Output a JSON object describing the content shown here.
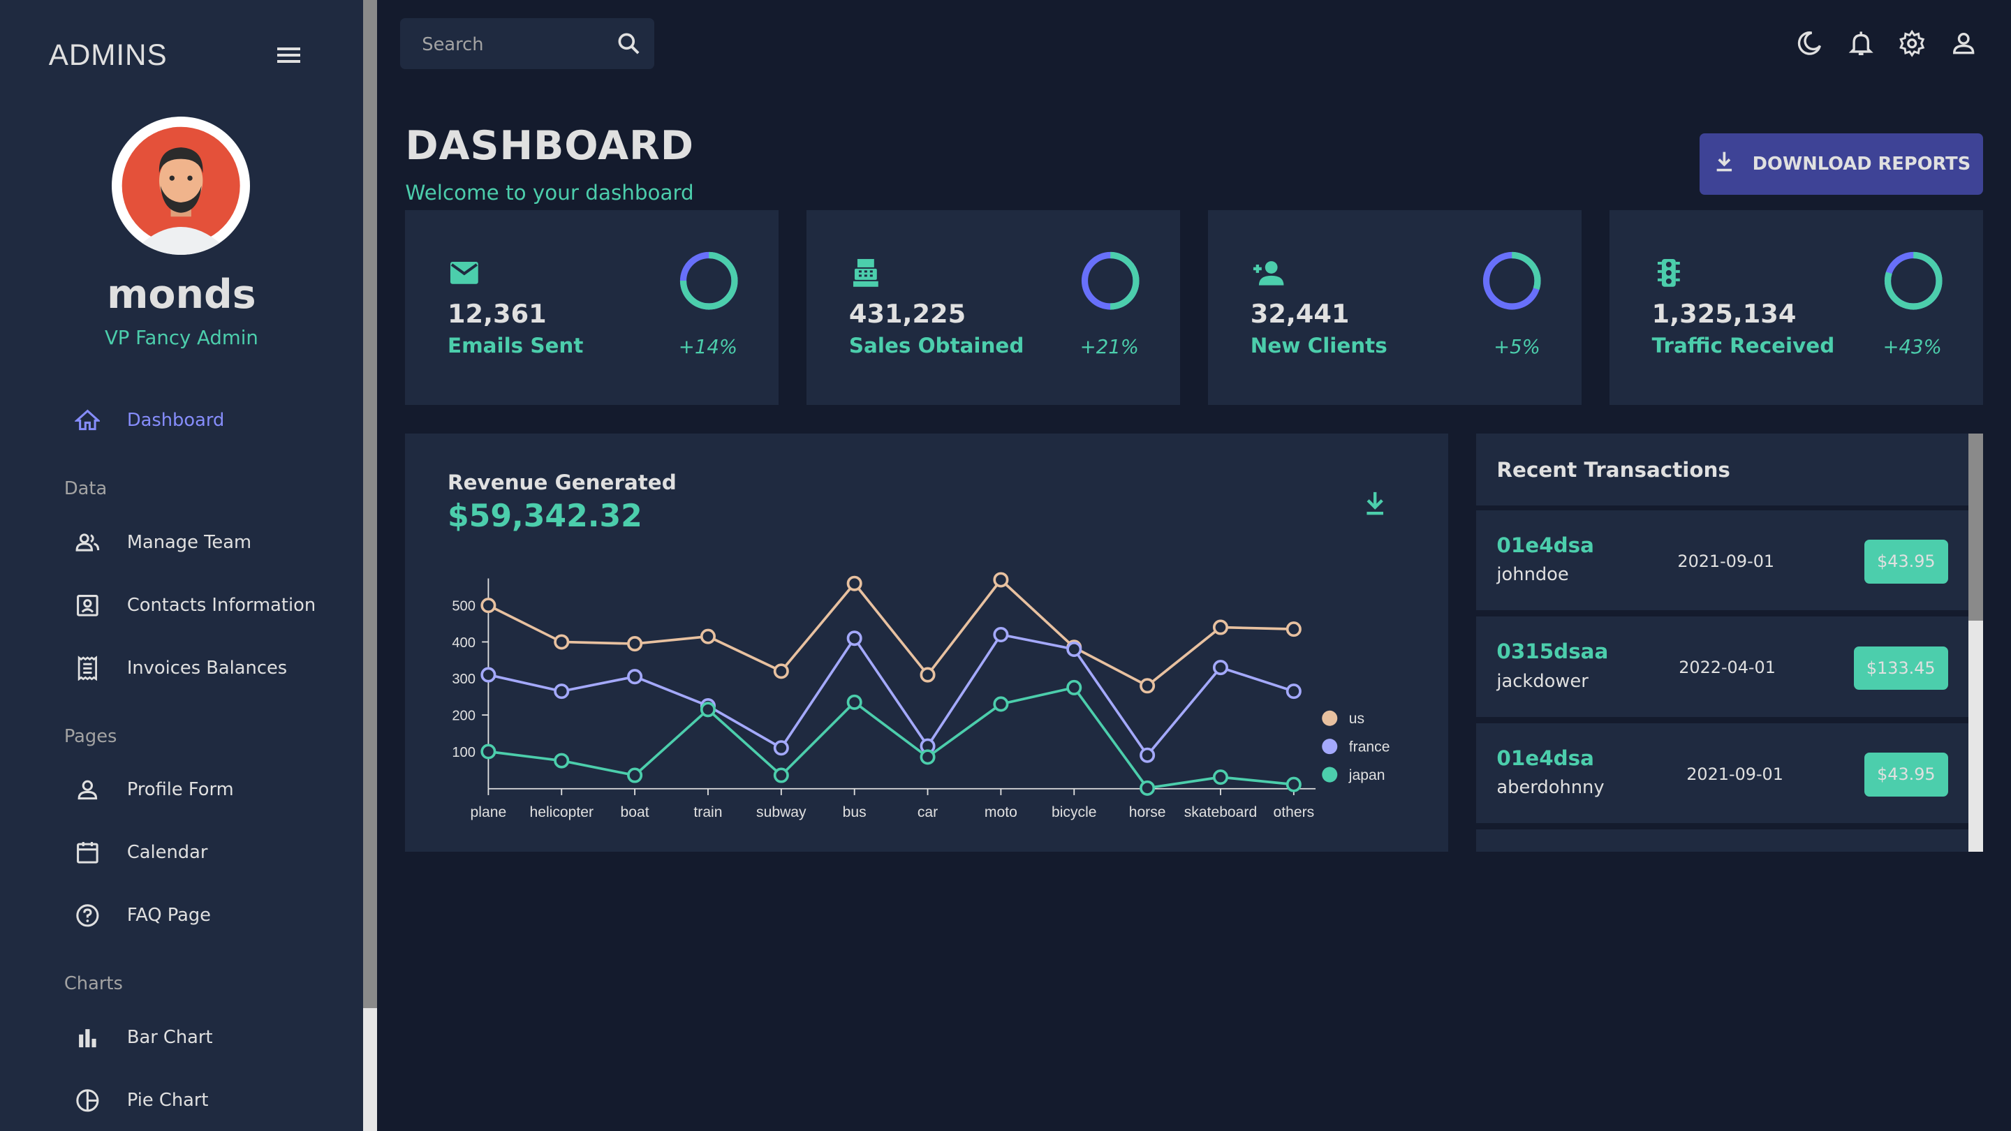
{
  "sidebar": {
    "brand": "ADMINS",
    "user": {
      "name": "monds",
      "role": "VP Fancy Admin"
    },
    "items": [
      {
        "label": "Dashboard",
        "icon": "home-icon",
        "active": true
      },
      {
        "section": "Data"
      },
      {
        "label": "Manage Team",
        "icon": "people-icon"
      },
      {
        "label": "Contacts Information",
        "icon": "contacts-icon"
      },
      {
        "label": "Invoices Balances",
        "icon": "receipt-icon"
      },
      {
        "section": "Pages"
      },
      {
        "label": "Profile Form",
        "icon": "person-icon"
      },
      {
        "label": "Calendar",
        "icon": "calendar-icon"
      },
      {
        "label": "FAQ Page",
        "icon": "help-icon"
      },
      {
        "section": "Charts"
      },
      {
        "label": "Bar Chart",
        "icon": "bar-chart-icon"
      },
      {
        "label": "Pie Chart",
        "icon": "pie-chart-icon"
      }
    ]
  },
  "topbar": {
    "search_placeholder": "Search",
    "icons": [
      "dark-mode-icon",
      "notifications-icon",
      "settings-icon",
      "person-icon"
    ]
  },
  "header": {
    "title": "DASHBOARD",
    "subtitle": "Welcome to your dashboard",
    "download_label": "DOWNLOAD REPORTS"
  },
  "stats": [
    {
      "value": "12,361",
      "label": "Emails Sent",
      "increase": "+14%",
      "progress": 0.75,
      "icon": "email-icon"
    },
    {
      "value": "431,225",
      "label": "Sales Obtained",
      "increase": "+21%",
      "progress": 0.5,
      "icon": "point-of-sale-icon"
    },
    {
      "value": "32,441",
      "label": "New Clients",
      "increase": "+5%",
      "progress": 0.3,
      "icon": "person-add-icon"
    },
    {
      "value": "1,325,134",
      "label": "Traffic Received",
      "increase": "+43%",
      "progress": 0.8,
      "icon": "traffic-icon"
    }
  ],
  "revenue": {
    "title": "Revenue Generated",
    "amount": "$59,342.32"
  },
  "chart_data": {
    "type": "line",
    "categories": [
      "plane",
      "helicopter",
      "boat",
      "train",
      "subway",
      "bus",
      "car",
      "moto",
      "bicycle",
      "horse",
      "skateboard",
      "others"
    ],
    "y_ticks": [
      100,
      200,
      300,
      400,
      500
    ],
    "ylim": [
      0,
      600
    ],
    "legend": "right",
    "grid": false,
    "series": [
      {
        "name": "us",
        "color": "#e8c1a0",
        "values": [
          500,
          400,
          395,
          415,
          320,
          560,
          310,
          570,
          385,
          280,
          440,
          435
        ]
      },
      {
        "name": "france",
        "color": "#a4a9fc",
        "values": [
          310,
          265,
          305,
          225,
          110,
          410,
          115,
          420,
          380,
          90,
          330,
          265
        ]
      },
      {
        "name": "japan",
        "color": "#4cceac",
        "values": [
          100,
          75,
          35,
          215,
          35,
          235,
          85,
          230,
          275,
          0,
          30,
          10
        ]
      }
    ]
  },
  "transactions": {
    "title": "Recent Transactions",
    "rows": [
      {
        "txId": "01e4dsa",
        "user": "johndoe",
        "date": "2021-09-01",
        "cost": "$43.95"
      },
      {
        "txId": "0315dsaa",
        "user": "jackdower",
        "date": "2022-04-01",
        "cost": "$133.45"
      },
      {
        "txId": "01e4dsa",
        "user": "aberdohnny",
        "date": "2021-09-01",
        "cost": "$43.95"
      }
    ]
  }
}
